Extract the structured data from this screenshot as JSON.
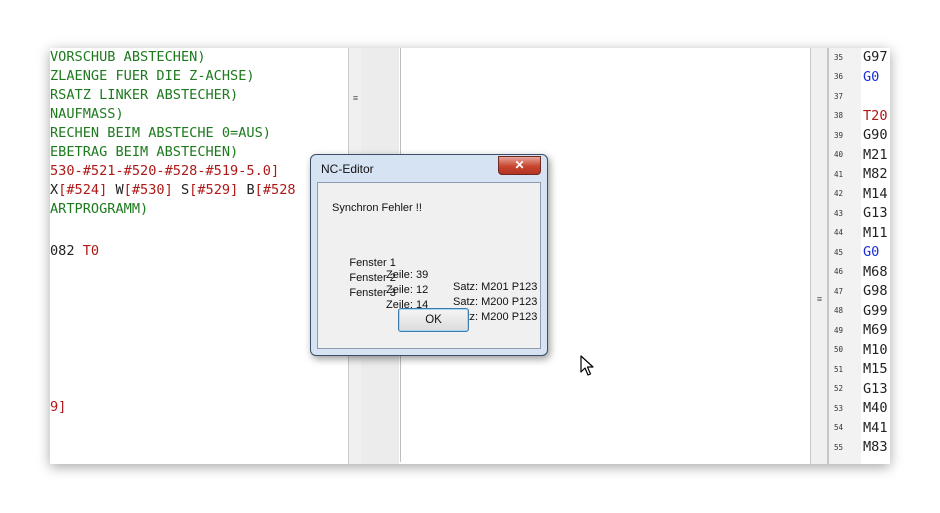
{
  "editor_left": {
    "lines": [
      {
        "text": "VORSCHUB ABSTECHEN)",
        "color": "#1e7a1e"
      },
      {
        "text": "ZLAENGE FUER DIE Z-ACHSE)",
        "color": "#1e7a1e"
      },
      {
        "text": "RSATZ LINKER ABSTECHER)",
        "color": "#1e7a1e"
      },
      {
        "text": "NAUFMASS)",
        "color": "#1e7a1e"
      },
      {
        "text": "RECHEN BEIM ABSTECHE 0=AUS)",
        "color": "#1e7a1e"
      },
      {
        "text": "EBETRAG BEIM ABSTECHEN)",
        "color": "#1e7a1e"
      },
      {
        "text": "530-#521-#520-#528-#519-5.0]",
        "color": "#b01818"
      },
      {
        "text": "ARTPROGRAMM)",
        "color": "#1e7a1e"
      }
    ],
    "line_axis": {
      "x": "X",
      "x_val": "[#524]",
      "w": "W",
      "w_val": "[#530]",
      "s": "S",
      "s_val": "[#529]",
      "b": "B",
      "b_val": "[#528"
    },
    "line_082": {
      "num": "082",
      "tool": "T0"
    },
    "line_9": "9]"
  },
  "gutter": {
    "numbers": [
      "35",
      "36",
      "37",
      "38",
      "39",
      "40",
      "41",
      "42",
      "43",
      "44",
      "45",
      "46",
      "47",
      "48",
      "49",
      "50",
      "51",
      "52",
      "53",
      "54",
      "55"
    ]
  },
  "editor_right": {
    "lines": [
      {
        "text": "G97",
        "color": "#222222"
      },
      {
        "text": "G0",
        "color": "#1a2fd6"
      },
      {
        "text": "",
        "color": "#222222"
      },
      {
        "text": "T20",
        "color": "#b01818"
      },
      {
        "text": "G90",
        "color": "#222222"
      },
      {
        "text": "M21",
        "color": "#222222"
      },
      {
        "text": "M82",
        "color": "#222222"
      },
      {
        "text": "M14",
        "color": "#222222"
      },
      {
        "text": "G13",
        "color": "#222222"
      },
      {
        "text": "M11",
        "color": "#222222"
      },
      {
        "text": "G0",
        "color": "#1a2fd6"
      },
      {
        "text": "M68",
        "color": "#222222"
      },
      {
        "text": "G98",
        "color": "#222222"
      },
      {
        "text": "G99",
        "color": "#222222"
      },
      {
        "text": "M69",
        "color": "#222222"
      },
      {
        "text": "M10",
        "color": "#222222"
      },
      {
        "text": "M15",
        "color": "#222222"
      },
      {
        "text": "G13",
        "color": "#222222"
      },
      {
        "text": "M40",
        "color": "#222222"
      },
      {
        "text": "M41",
        "color": "#222222"
      },
      {
        "text": "M83",
        "color": "#222222"
      }
    ]
  },
  "dialog": {
    "title": "NC-Editor",
    "close_label": "✕",
    "message": "Synchron Fehler !!",
    "rows": [
      {
        "fenster": "Fenster 1",
        "zeile": "Zeile: 39",
        "satz": "Satz: M201 P123"
      },
      {
        "fenster": "Fenster 2",
        "zeile": "Zeile: 12",
        "satz": "Satz: M200 P123"
      },
      {
        "fenster": "Fenster 3",
        "zeile": "Zeile: 14",
        "satz": "Satz: M200 P123"
      }
    ],
    "ok_label": "OK"
  },
  "icons": {
    "splitter_grip": "≡",
    "cursor": "mouse-pointer-icon"
  }
}
